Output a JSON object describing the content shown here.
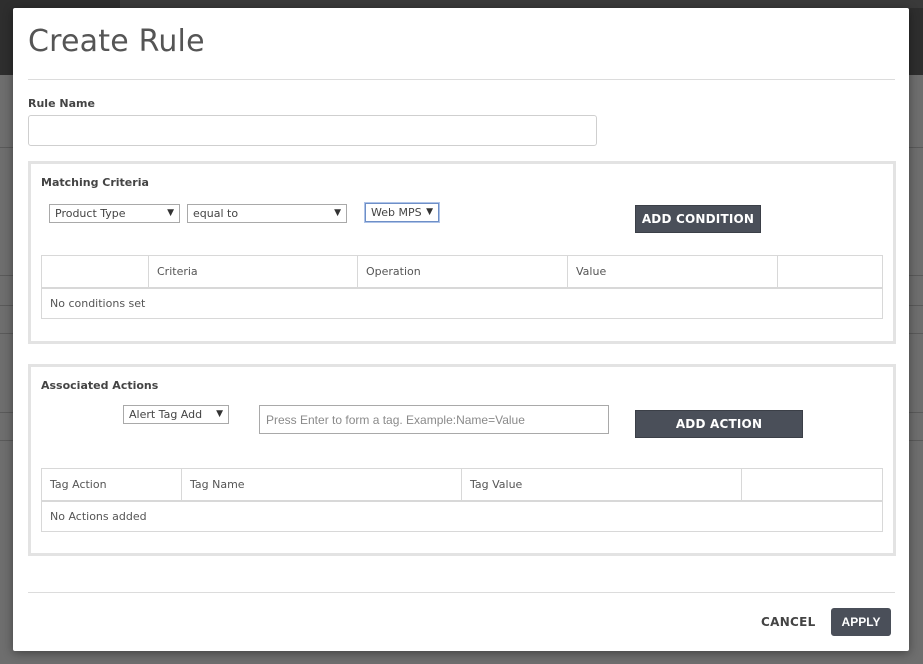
{
  "modal": {
    "title": "Create Rule",
    "rule_name": {
      "label": "Rule Name",
      "value": "",
      "placeholder": ""
    }
  },
  "matching_criteria": {
    "heading": "Matching Criteria",
    "criteria_select": "Product Type",
    "operation_select": "equal to",
    "value_select": "Web MPS",
    "add_button": "ADD CONDITION",
    "table": {
      "columns": [
        "",
        "Criteria",
        "Operation",
        "Value",
        ""
      ],
      "empty_text": "No conditions set"
    }
  },
  "associated_actions": {
    "heading": "Associated Actions",
    "action_select": "Alert Tag Add",
    "tag_input": {
      "value": "",
      "placeholder": "Press Enter to form a tag. Example:Name=Value"
    },
    "add_button": "ADD ACTION",
    "table": {
      "columns": [
        "Tag Action",
        "Tag Name",
        "Tag Value",
        ""
      ],
      "empty_text": "No Actions added"
    }
  },
  "footer": {
    "cancel": "CANCEL",
    "apply": "APPLY"
  },
  "icons": {
    "caret": "caret-down-icon"
  },
  "colors": {
    "primary_button": "#4a4f59",
    "section_border": "#e3e3e3"
  }
}
